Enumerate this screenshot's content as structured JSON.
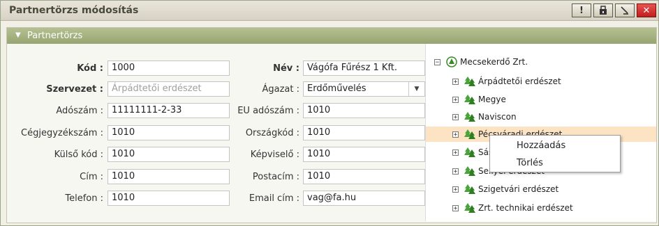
{
  "window": {
    "title": "Partnertörzs módosítás"
  },
  "titlebar_buttons": [
    "!",
    "",
    "",
    "✕"
  ],
  "section": {
    "title": "Partnertörzs"
  },
  "form": {
    "kod": {
      "label": "Kód :",
      "value": "1000"
    },
    "szervezet": {
      "label": "Szervezet :",
      "placeholder": "Árpádtetői erdészet"
    },
    "adoszam": {
      "label": "Adószám :",
      "value": "11111111-2-33"
    },
    "cegjegyzekszam": {
      "label": "Cégjegyzékszám :",
      "value": "1010"
    },
    "kulso_kod": {
      "label": "Külső kód :",
      "value": "1010"
    },
    "cim": {
      "label": "Cím :",
      "value": "1010"
    },
    "telefon": {
      "label": "Telefon :",
      "value": "1010"
    },
    "nev": {
      "label": "Név :",
      "value": "Vágófa Fűrész 1 Kft."
    },
    "agazat": {
      "label": "Ágazat :",
      "value": "Erdőművelés"
    },
    "eu_adoszam": {
      "label": "EU adószám :",
      "value": "1010"
    },
    "orszagkod": {
      "label": "Országkód :",
      "value": "1010"
    },
    "kepviselo": {
      "label": "Képviselő :",
      "value": "1010"
    },
    "postacim": {
      "label": "Postacím :",
      "value": "1010"
    },
    "email": {
      "label": "Email cím :",
      "value": "vag@fa.hu"
    }
  },
  "tree": {
    "root": "Mecsekerdő Zrt.",
    "children": [
      "Árpádtetői erdészet",
      "Megye",
      "Naviscon",
      "Pécsváradi erdészet",
      "Sásdi erdészet",
      "Sellyei erdészet",
      "Szigetvári erdészet",
      "Zrt. technikai erdészet"
    ],
    "selected": "Pécsváradi erdészet"
  },
  "context_menu": {
    "items": [
      "Hozzáadás",
      "Törlés"
    ]
  },
  "colors": {
    "accent": "#9dab78",
    "highlight": "#fbe3c3",
    "close": "#d0302c"
  }
}
